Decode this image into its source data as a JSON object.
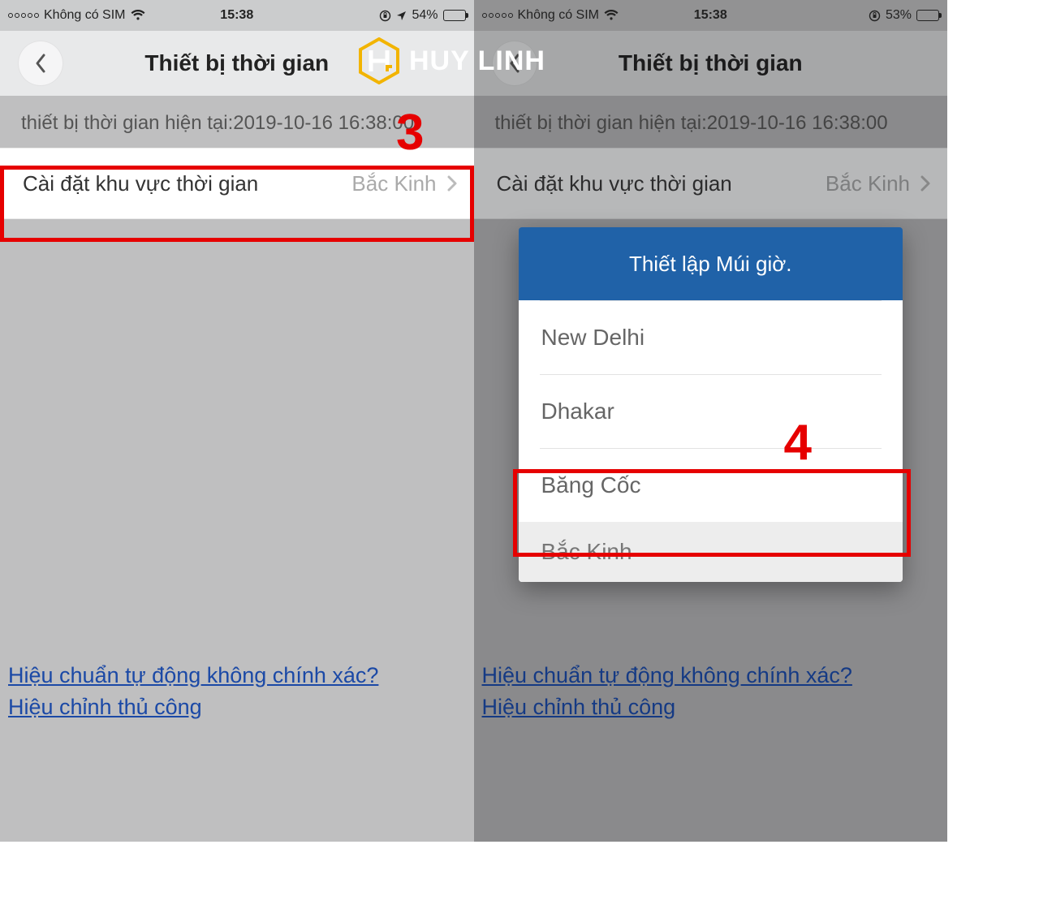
{
  "logo": {
    "text": "HUY LINH"
  },
  "left": {
    "status": {
      "carrier": "Không có SIM",
      "time": "15:38",
      "battery_pct": "54%",
      "battery_fill_pct": 54
    },
    "nav": {
      "title": "Thiết bị thời gian"
    },
    "info": "thiết bị thời gian hiện tại:2019-10-16 16:38:00",
    "row": {
      "label": "Cài đặt khu vực thời gian",
      "value": "Bắc Kinh"
    },
    "bottom_link": {
      "line1": "Hiệu chuẩn tự động không chính xác?",
      "line2": "Hiệu chỉnh thủ công"
    },
    "annotation_number": "3"
  },
  "right": {
    "status": {
      "carrier": "Không có SIM",
      "time": "15:38",
      "battery_pct": "53%",
      "battery_fill_pct": 53
    },
    "nav": {
      "title": "Thiết bị thời gian"
    },
    "info": "thiết bị thời gian hiện tại:2019-10-16 16:38:00",
    "row": {
      "label": "Cài đặt khu vực thời gian",
      "value": "Bắc Kinh"
    },
    "bottom_link": {
      "line1": "Hiệu chuẩn tự động không chính xác?",
      "line2": "Hiệu chỉnh thủ công"
    },
    "sheet": {
      "title": "Thiết lập Múi giờ.",
      "items": [
        "New Delhi",
        "Dhakar",
        "Băng Cốc",
        "Bắc Kinh"
      ]
    },
    "annotation_number": "4"
  }
}
